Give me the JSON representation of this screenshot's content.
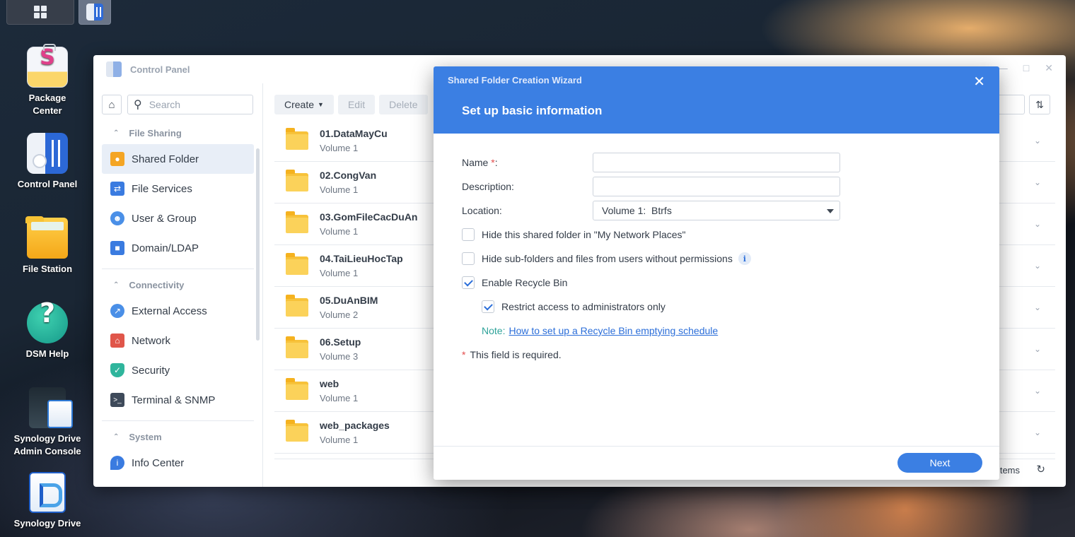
{
  "desktop": {
    "icons": [
      {
        "label": "Package Center",
        "icon": "package-center-icon"
      },
      {
        "label": "Control Panel",
        "icon": "control-panel-icon"
      },
      {
        "label": "File Station",
        "icon": "file-station-icon"
      },
      {
        "label": "DSM Help",
        "icon": "dsm-help-icon"
      },
      {
        "label": "Synology Drive Admin Console",
        "icon": "synology-drive-admin-icon"
      },
      {
        "label": "Synology Drive",
        "icon": "synology-drive-icon"
      }
    ]
  },
  "control_panel": {
    "title": "Control Panel",
    "search_placeholder": "Search",
    "sidebar": {
      "sections": [
        {
          "label": "File Sharing",
          "items": [
            {
              "label": "Shared Folder",
              "icon": "shared-folder-icon",
              "active": true
            },
            {
              "label": "File Services",
              "icon": "file-services-icon"
            },
            {
              "label": "User & Group",
              "icon": "user-group-icon"
            },
            {
              "label": "Domain/LDAP",
              "icon": "domain-ldap-icon"
            }
          ]
        },
        {
          "label": "Connectivity",
          "items": [
            {
              "label": "External Access",
              "icon": "external-access-icon"
            },
            {
              "label": "Network",
              "icon": "network-icon"
            },
            {
              "label": "Security",
              "icon": "security-icon"
            },
            {
              "label": "Terminal & SNMP",
              "icon": "terminal-icon"
            }
          ]
        },
        {
          "label": "System",
          "items": [
            {
              "label": "Info Center",
              "icon": "info-center-icon"
            }
          ]
        }
      ]
    },
    "toolbar": {
      "create": "Create",
      "edit": "Edit",
      "delete": "Delete"
    },
    "folders": [
      {
        "name": "01.DataMayCu",
        "volume": "Volume 1"
      },
      {
        "name": "02.CongVan",
        "volume": "Volume 1"
      },
      {
        "name": "03.GomFileCacDuAn",
        "volume": "Volume 1"
      },
      {
        "name": "04.TaiLieuHocTap",
        "volume": "Volume 1"
      },
      {
        "name": "05.DuAnBIM",
        "volume": "Volume 2"
      },
      {
        "name": "06.Setup",
        "volume": "Volume 3"
      },
      {
        "name": "web",
        "volume": "Volume 1"
      },
      {
        "name": "web_packages",
        "volume": "Volume 1"
      }
    ],
    "footer_items": "items"
  },
  "wizard": {
    "window_title": "Shared Folder Creation Wizard",
    "step_title": "Set up basic information",
    "fields": {
      "name_label": "Name",
      "name_value": "",
      "description_label": "Description:",
      "description_value": "",
      "location_label": "Location:",
      "location_value": "Volume 1:  Btrfs"
    },
    "options": {
      "hide_network_places": {
        "label": "Hide this shared folder in \"My Network Places\"",
        "checked": false
      },
      "hide_subfolders": {
        "label": "Hide sub-folders and files from users without permissions",
        "checked": false
      },
      "enable_recycle_bin": {
        "label": "Enable Recycle Bin",
        "checked": true
      },
      "restrict_admin": {
        "label": "Restrict access to administrators only",
        "checked": true
      }
    },
    "note_label": "Note:",
    "note_link": "How to set up a Recycle Bin emptying schedule",
    "required_note": "This field is required.",
    "next_button": "Next"
  },
  "colors": {
    "accent": "#3b7fe3",
    "note": "#2fa39a",
    "required": "#e34d4d"
  }
}
